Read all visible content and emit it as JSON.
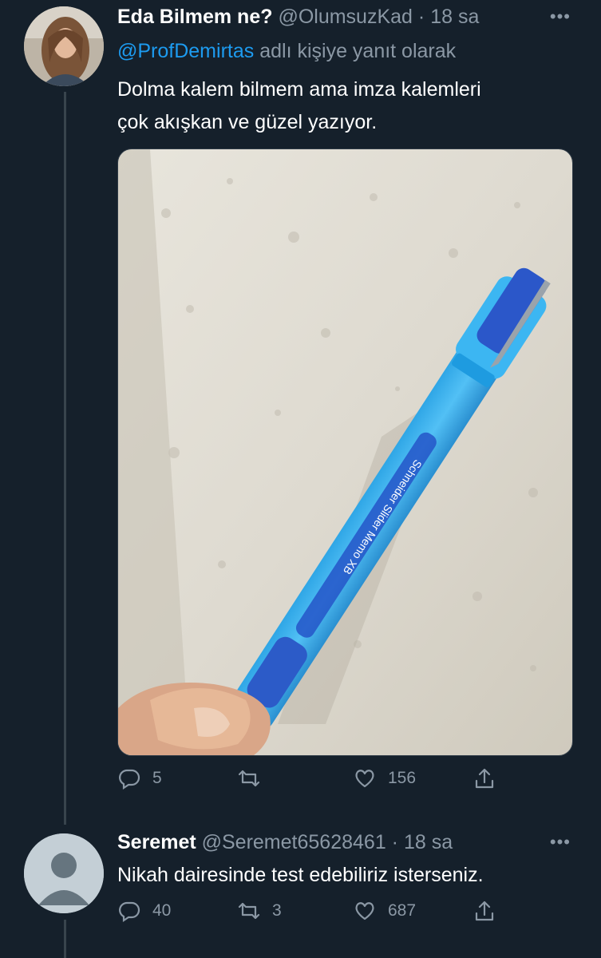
{
  "tweets": [
    {
      "name": "Eda Bilmem ne?",
      "handle": "@OlumsuzKad",
      "separator": "·",
      "time": "18 sa",
      "more": "•••",
      "reply_to_mention": "@ProfDemirtas",
      "reply_to_suffix": "adlı kişiye yanıt olarak",
      "text_line1": "Dolma kalem bilmem ama imza kalemleri",
      "text_line2": "çok akışkan ve güzel yazıyor.",
      "pen_print": "Schneider  Slider Memo XB",
      "replies": "5",
      "retweets": "",
      "likes": "156"
    },
    {
      "name": "Seremet",
      "handle": "@Seremet65628461",
      "separator": "·",
      "time": "18 sa",
      "more": "•••",
      "text": "Nikah dairesinde test edebiliriz isterseniz.",
      "replies": "40",
      "retweets": "3",
      "likes": "687"
    }
  ],
  "icons": {
    "reply": "speech-bubble-icon",
    "retweet": "retweet-arrows-icon",
    "like": "heart-icon",
    "share": "share-upload-icon"
  },
  "colors": {
    "background": "#15202b",
    "text": "#ffffff",
    "secondary": "#8b98a5",
    "link": "#1d9bf0",
    "thread_line": "#38444d"
  }
}
